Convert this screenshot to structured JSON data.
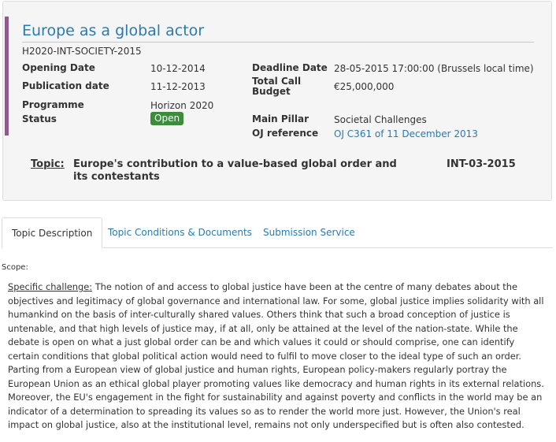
{
  "header": {
    "title": "Europe as a global actor",
    "identifier": "H2020-INT-SOCIETY-2015"
  },
  "fields": {
    "opening_date_label": "Opening Date",
    "opening_date": "10-12-2014",
    "publication_date_label": "Publication date",
    "publication_date": "11-12-2013",
    "programme_label": "Programme",
    "programme": "Horizon 2020",
    "status_label": "Status",
    "status": "Open",
    "deadline_label": "Deadline Date",
    "deadline": "28-05-2015 17:00:00 (Brussels local time)",
    "budget_label_1": "Total Call",
    "budget_label_2": "Budget",
    "budget": "€25,000,000",
    "pillar_label": "Main Pillar",
    "pillar": "Societal Challenges",
    "oj_label": "OJ reference",
    "oj_ref": "OJ C361 of 11 December 2013"
  },
  "topic": {
    "label": "Topic:",
    "title": "Europe's contribution to a value-based global order and its contestants",
    "code": "INT-03-2015"
  },
  "tabs": [
    {
      "label": "Topic Description",
      "active": true
    },
    {
      "label": "Topic Conditions & Documents",
      "active": false
    },
    {
      "label": "Submission Service",
      "active": false
    }
  ],
  "content": {
    "scope_label": "Scope:",
    "challenge_label": "Specific challenge:",
    "challenge_text": "The notion of and access to global justice have been at the centre of many debates about the objectives and legitimacy of global governance and international law. For some, global justice implies solidarity with all humankind on the basis of inter-culturally shared values. Others think that such a broad conception of justice is untenable, and that high levels of justice may, if at all, only be attained at the level of the nation-state. While the debate is open on what a just global order can be and which values it could or should comprise, one can identify certain conditions that global political action would need to fulfil to move closer to the ideal type of such an order. Parting from a European view of global justice and human rights, European policy-makers regularly portray the European Union as an ethical global player promoting values like democracy and human rights in its external relations. Moreover, the EU's engagement in the fight for sustainability and against poverty and conflicts in the world may be an indicator of a determination to spreading its values so as to render the world more just. However, the Union's real impact on global justice, also at the institutional level, remains not only underspecified but is often also contested."
  },
  "colors": {
    "accent": "#8e5b8b",
    "link": "#2a7ab0",
    "status_open": "#3c8c3c"
  }
}
